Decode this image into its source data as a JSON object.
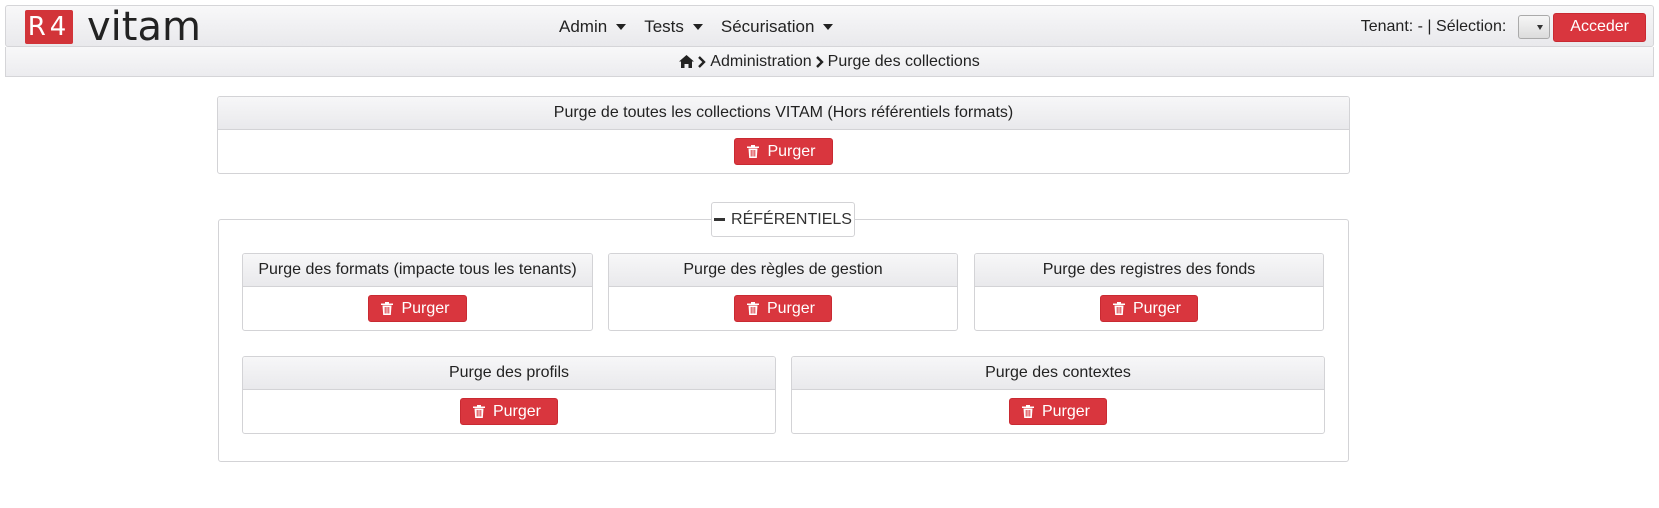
{
  "navbar": {
    "logo_badge": "R4",
    "logo_text": "vitam",
    "menu": [
      {
        "label": "Admin"
      },
      {
        "label": "Tests"
      },
      {
        "label": "Sécurisation"
      }
    ],
    "tenant_text": "Tenant: - | Sélection:",
    "acceder_label": "Acceder"
  },
  "breadcrumb": {
    "items": [
      "Administration",
      "Purge des collections"
    ]
  },
  "top_panel": {
    "title": "Purge de toutes les collections VITAM (Hors référentiels formats)",
    "button": "Purger"
  },
  "referentiels": {
    "legend": "RÉFÉRENTIELS",
    "panels": [
      {
        "title": "Purge des formats (impacte tous les tenants)",
        "button": "Purger"
      },
      {
        "title": "Purge des règles de gestion",
        "button": "Purger"
      },
      {
        "title": "Purge des registres des fonds",
        "button": "Purger"
      },
      {
        "title": "Purge des profils",
        "button": "Purger"
      },
      {
        "title": "Purge des contextes",
        "button": "Purger"
      }
    ]
  },
  "colors": {
    "accent": "#d9363e",
    "header_bg": "#efeff1",
    "border": "#d3d3d6"
  },
  "icons": {
    "home": "home-icon",
    "chevron": "chevron-right-icon",
    "trash": "trash-icon",
    "minus": "minus-icon"
  }
}
